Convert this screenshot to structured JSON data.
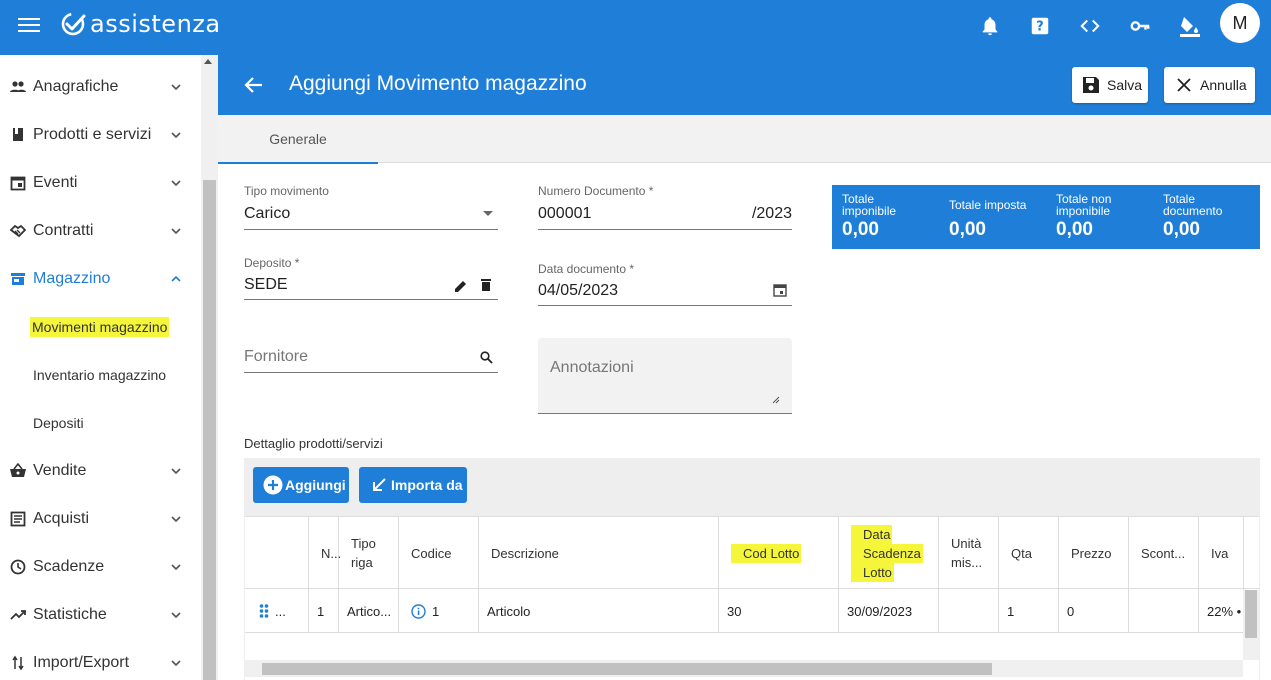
{
  "app": {
    "name": "assistenza",
    "avatar_initial": "M"
  },
  "topbar_icons": [
    "bell-icon",
    "help-icon",
    "code-icon",
    "key-icon",
    "paint-bucket-icon"
  ],
  "sidebar": {
    "items": [
      {
        "label": "Anagrafiche",
        "icon": "people-icon"
      },
      {
        "label": "Prodotti e servizi",
        "icon": "book-icon"
      },
      {
        "label": "Eventi",
        "icon": "calendar-icon"
      },
      {
        "label": "Contratti",
        "icon": "handshake-icon"
      },
      {
        "label": "Magazzino",
        "icon": "store-icon",
        "expanded": true
      },
      {
        "label": "Vendite",
        "icon": "basket-icon"
      },
      {
        "label": "Acquisti",
        "icon": "list-icon"
      },
      {
        "label": "Scadenze",
        "icon": "clock-icon"
      },
      {
        "label": "Statistiche",
        "icon": "trending-icon"
      },
      {
        "label": "Import/Export",
        "icon": "swap-icon"
      }
    ],
    "subitems": [
      {
        "label": "Movimenti magazzino",
        "highlighted": true
      },
      {
        "label": "Inventario magazzino"
      },
      {
        "label": "Depositi"
      }
    ]
  },
  "header": {
    "title": "Aggiungi Movimento magazzino",
    "save_label": "Salva",
    "cancel_label": "Annulla"
  },
  "tabs": [
    {
      "label": "Generale",
      "active": true
    }
  ],
  "form": {
    "tipo_movimento": {
      "label": "Tipo movimento",
      "value": "Carico"
    },
    "numero_documento": {
      "label": "Numero Documento *",
      "value": "000001",
      "suffix": "/2023"
    },
    "deposito": {
      "label": "Deposito *",
      "value": "SEDE"
    },
    "data_documento": {
      "label": "Data documento *",
      "value": "04/05/2023"
    },
    "fornitore": {
      "placeholder": "Fornitore"
    },
    "annotazioni": {
      "placeholder": "Annotazioni"
    }
  },
  "totals": [
    {
      "label_line1": "Totale",
      "label_line2": "imponibile",
      "value": "0,00"
    },
    {
      "label_line1": "Totale imposta",
      "label_line2": "",
      "value": "0,00"
    },
    {
      "label_line1": "Totale non",
      "label_line2": "imponibile",
      "value": "0,00"
    },
    {
      "label_line1": "Totale",
      "label_line2": "documento",
      "value": "0,00"
    }
  ],
  "detail": {
    "title": "Dettaglio prodotti/servizi",
    "add_label": "Aggiungi",
    "import_label": "Importa da",
    "columns": [
      {
        "label": "",
        "lines": []
      },
      {
        "label": "N...",
        "lines": [
          "N..."
        ]
      },
      {
        "label": "Tipo riga",
        "lines": [
          "Tipo",
          "riga"
        ]
      },
      {
        "label": "Codice",
        "lines": [
          "Codice"
        ]
      },
      {
        "label": "Descrizione",
        "lines": [
          "Descrizione"
        ]
      },
      {
        "label": "Cod Lotto",
        "lines": [
          "Cod Lotto"
        ],
        "highlighted": true
      },
      {
        "label": "Data Scadenza Lotto",
        "lines": [
          "Data",
          "Scadenza",
          "Lotto"
        ],
        "highlighted": true
      },
      {
        "label": "Unità mis...",
        "lines": [
          "Unità",
          "mis..."
        ]
      },
      {
        "label": "Qta",
        "lines": [
          "Qta"
        ]
      },
      {
        "label": "Prezzo",
        "lines": [
          "Prezzo"
        ]
      },
      {
        "label": "Scont...",
        "lines": [
          "Scont..."
        ]
      },
      {
        "label": "Iva",
        "lines": [
          "Iva"
        ]
      }
    ],
    "rows": [
      {
        "handle": "...",
        "n": "1",
        "tipo": "Artico...",
        "codice": "1",
        "descrizione": "Articolo",
        "lotto": "30",
        "scadenza": "30/09/2023",
        "unita": "",
        "qta": "1",
        "prezzo": "0",
        "sconto": "",
        "iva": "22% •"
      }
    ]
  }
}
